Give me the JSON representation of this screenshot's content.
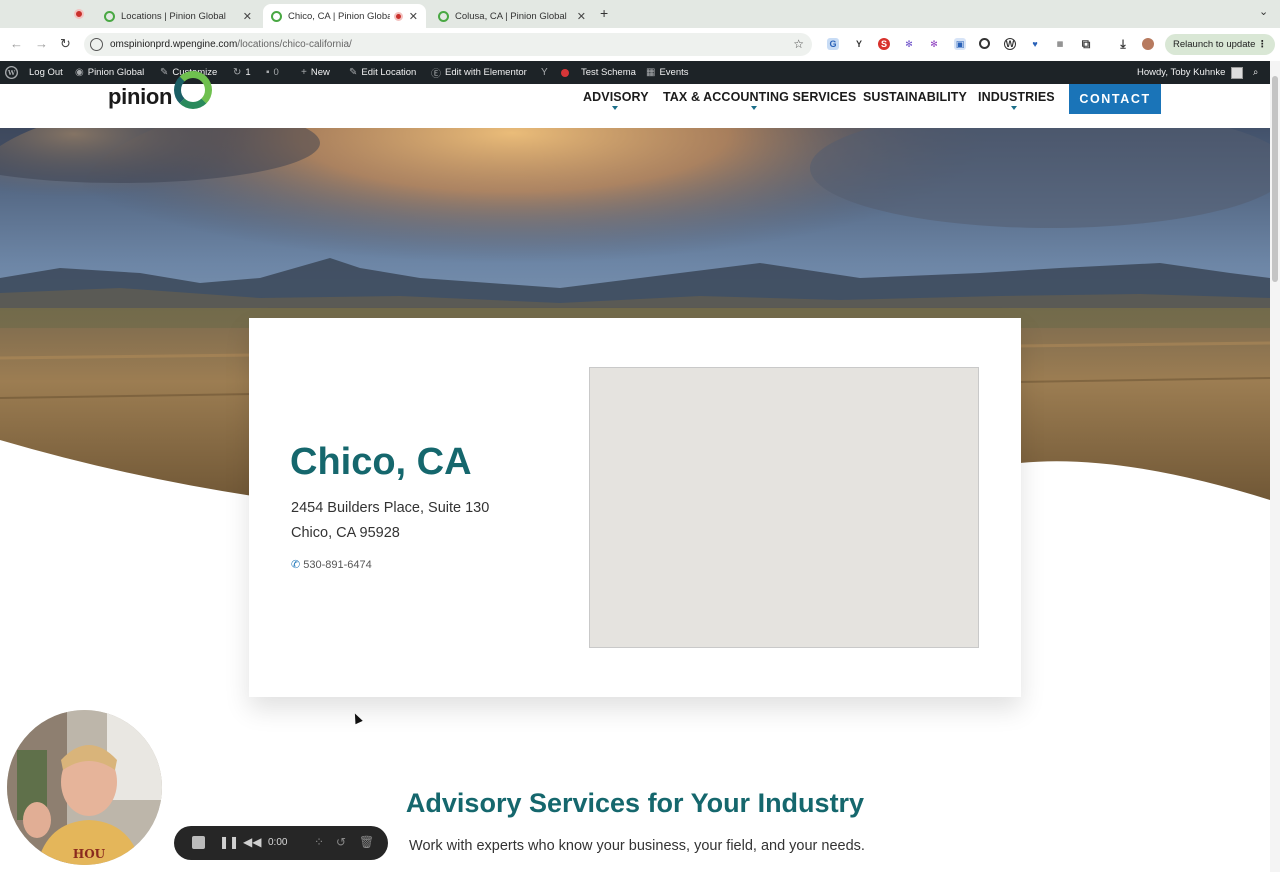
{
  "browser": {
    "tabs": [
      {
        "title": "Locations | Pinion Global",
        "active": false
      },
      {
        "title": "Chico, CA | Pinion Global",
        "active": true
      },
      {
        "title": "Colusa, CA | Pinion Global",
        "active": false
      }
    ],
    "url_host": "omspinionprd.wpengine.com",
    "url_path": "/locations/chico-california/",
    "relaunch_label": "Relaunch to update"
  },
  "adminbar": {
    "logout": "Log Out",
    "site_name": "Pinion Global",
    "customize": "Customize",
    "updates_count": "1",
    "comments_count": "0",
    "new": "New",
    "edit_location": "Edit Location",
    "edit_elementor": "Edit with Elementor",
    "test_schema": "Test Schema",
    "events": "Events",
    "howdy": "Howdy, Toby Kuhnke"
  },
  "site": {
    "logo_text": "pinion",
    "nav": [
      "ADVISORY",
      "TAX & ACCOUNTING SERVICES",
      "SUSTAINABILITY",
      "INDUSTRIES"
    ],
    "contact_label": "CONTACT"
  },
  "location": {
    "title": "Chico, CA",
    "address_line1": "2454 Builders Place, Suite 130",
    "address_line2": "Chico, CA 95928",
    "phone": "530-891-6474"
  },
  "section": {
    "title": "Advisory Services for Your Industry",
    "subtitle": "Work with experts who know your business, your field, and your needs."
  },
  "recorder": {
    "time": "0:00"
  },
  "colors": {
    "brand_teal": "#15676d",
    "brand_blue": "#1a74b8",
    "brand_green": "#6fc04f",
    "admin_bar": "#1d2327"
  }
}
